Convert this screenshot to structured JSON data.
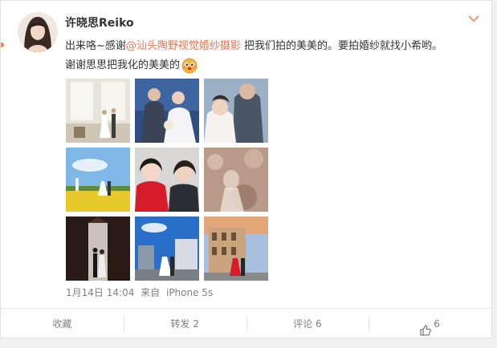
{
  "post": {
    "username": "许晓思Reiko",
    "text_part1": "出来咯~感谢",
    "mention": "@汕头陶野视觉婚纱摄影",
    "text_part2": " 把我们拍的美美的。要拍婚纱就找小希哟。",
    "text_line2": "谢谢思思把我化的美美的",
    "emoji": "cute-face-emoji",
    "time": "1月14日 14:04",
    "source_prefix": "来自",
    "source": "iPhone 5s"
  },
  "photos": [
    {
      "name": "photo-1",
      "scene": "wedding-indoor-window"
    },
    {
      "name": "photo-2",
      "scene": "couple-portrait-blue"
    },
    {
      "name": "photo-3",
      "scene": "couple-closeup-blue"
    },
    {
      "name": "photo-4",
      "scene": "couple-flower-field-sky"
    },
    {
      "name": "photo-5",
      "scene": "selfie-two-women"
    },
    {
      "name": "photo-6",
      "scene": "bride-soft-bokeh"
    },
    {
      "name": "photo-7",
      "scene": "couple-dark-doorway"
    },
    {
      "name": "photo-8",
      "scene": "couple-city-blue-sky"
    },
    {
      "name": "photo-9",
      "scene": "couple-red-dress-building"
    }
  ],
  "actions": {
    "favorite": "收藏",
    "repost": "转发 2",
    "comment": "评论 6",
    "like": "6"
  },
  "colors": {
    "accent": "#eb7350",
    "meta_text": "#808080",
    "background": "#eef0f2"
  }
}
